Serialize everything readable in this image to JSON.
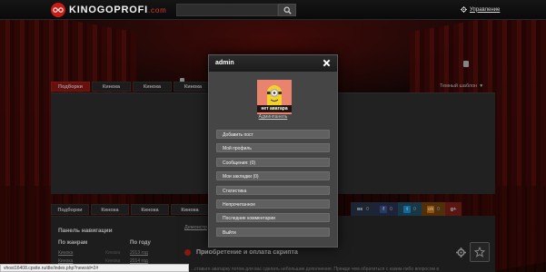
{
  "header": {
    "logo_text": "KINOGOPROFI",
    "logo_suffix": ".com",
    "search_placeholder": "",
    "management_label": "Управление"
  },
  "upper_tabs": [
    "Подборки",
    "Кинока",
    "Кинока",
    "Кинока"
  ],
  "theme_switch": {
    "label": "Темный шаблон"
  },
  "lower_tabs": [
    "Подборки",
    "Кинока",
    "Кинока",
    "Кинока"
  ],
  "social": {
    "vk": {
      "icon": "vk-icon",
      "glyph": "вк",
      "count": "0"
    },
    "fb": {
      "icon": "facebook-icon",
      "glyph": "f",
      "count": "0"
    },
    "tw": {
      "icon": "twitter-icon",
      "glyph": "t",
      "count": "0"
    },
    "ok": {
      "icon": "odnoklassniki-icon",
      "glyph": "ok",
      "count": "0"
    },
    "gp": {
      "icon": "google-plus-icon",
      "glyph": "g+"
    }
  },
  "sidebar": {
    "title": "Панель навигации",
    "col1_header": "По жанрам",
    "col2_header": "По году",
    "genres": [
      "Кинока",
      "Кинока"
    ],
    "years": [
      "2013 год",
      "2014 год"
    ]
  },
  "content": {
    "breadcrumb": "Демонстр",
    "post_title": "Приобретение и оплата скрипта",
    "body_text": "...ставьте аватарку потом для вас сделать небольшие дополнения. Прежде чем обратиться с каким-либо вопросом в"
  },
  "status_bar": {
    "url": "vhost16408.cpsite.ru/dle/index.php?newsid=2#"
  },
  "modal": {
    "title": "admin",
    "avatar_label": "нет аватара",
    "admin_link": "Админпанель",
    "menu": [
      "Добавить пост",
      "Мой профиль",
      "Сообщения: (0)",
      "Мои закладки (0)",
      "Статистика",
      "Непрочитанное",
      "Последние комментарии",
      "Выйти"
    ]
  },
  "colors": {
    "accent_red": "#c71d14",
    "active_tab": "#9e1a15",
    "modal_bg": "#454545"
  }
}
